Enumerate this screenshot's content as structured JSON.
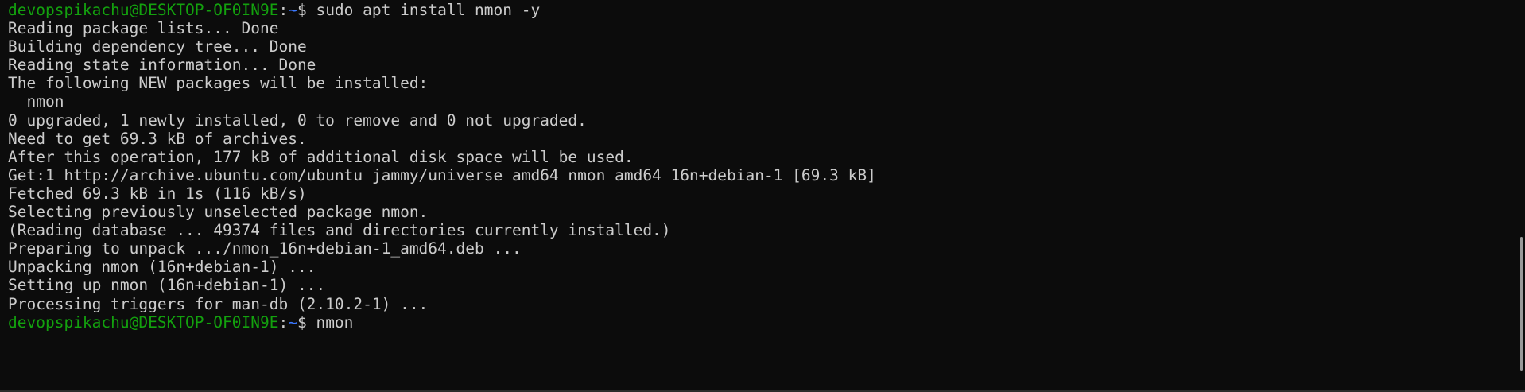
{
  "terminal": {
    "colors": {
      "background": "#0c0c0c",
      "text": "#cccccc",
      "user_host": "#13a10e",
      "path": "#3b78ff"
    },
    "prompt1": {
      "user_host": "devopspikachu@DESKTOP-OF0IN9E",
      "separator": ":",
      "path": "~",
      "symbol": "$ ",
      "command": "sudo apt install nmon -y"
    },
    "output": [
      "Reading package lists... Done",
      "Building dependency tree... Done",
      "Reading state information... Done",
      "The following NEW packages will be installed:",
      "  nmon",
      "0 upgraded, 1 newly installed, 0 to remove and 0 not upgraded.",
      "Need to get 69.3 kB of archives.",
      "After this operation, 177 kB of additional disk space will be used.",
      "Get:1 http://archive.ubuntu.com/ubuntu jammy/universe amd64 nmon amd64 16n+debian-1 [69.3 kB]",
      "Fetched 69.3 kB in 1s (116 kB/s)",
      "Selecting previously unselected package nmon.",
      "(Reading database ... 49374 files and directories currently installed.)",
      "Preparing to unpack .../nmon_16n+debian-1_amd64.deb ...",
      "Unpacking nmon (16n+debian-1) ...",
      "Setting up nmon (16n+debian-1) ...",
      "Processing triggers for man-db (2.10.2-1) ..."
    ],
    "prompt2": {
      "user_host": "devopspikachu@DESKTOP-OF0IN9E",
      "separator": ":",
      "path": "~",
      "symbol": "$ ",
      "command": "nmon"
    }
  }
}
